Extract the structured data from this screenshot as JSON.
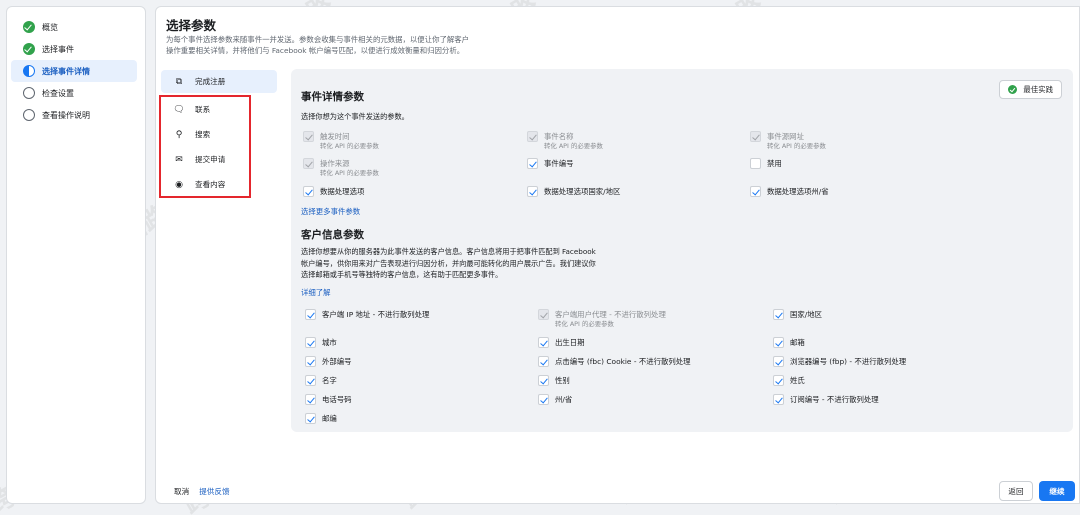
{
  "steps": [
    {
      "label": "概览",
      "state": "done"
    },
    {
      "label": "选择事件",
      "state": "done"
    },
    {
      "label": "选择事件详情",
      "state": "current"
    },
    {
      "label": "检查设置",
      "state": "todo"
    },
    {
      "label": "查看操作说明",
      "state": "todo"
    }
  ],
  "header": {
    "title": "选择参数",
    "desc_line1": "为每个事件选择参数来随事件一并发送。参数会收集与事件相关的元数据，以便让你了解客户",
    "desc_line2": "操作重要相关详情，并将他们与 Facebook 帐户编号匹配，以便进行成效衡量和归因分析。"
  },
  "events": [
    {
      "label": "完成注册",
      "icon": "register-icon",
      "glyph": "⧉"
    },
    {
      "label": "联系",
      "icon": "chat-icon",
      "glyph": "🗨"
    },
    {
      "label": "搜索",
      "icon": "search-icon",
      "glyph": "⚲"
    },
    {
      "label": "提交申请",
      "icon": "envelope-icon",
      "glyph": "✉"
    },
    {
      "label": "查看内容",
      "icon": "eye-icon",
      "glyph": "◉"
    }
  ],
  "event_details": {
    "title": "事件详情参数",
    "best_practice": "最佳实践",
    "desc": "选择你想为这个事件发送的参数。",
    "params": [
      {
        "label": "触发时间",
        "sub": "转化 API 的必要参数",
        "state": "disabled"
      },
      {
        "label": "事件名称",
        "sub": "转化 API 的必要参数",
        "state": "disabled"
      },
      {
        "label": "事件源网址",
        "sub": "转化 API 的必要参数",
        "state": "disabled"
      },
      {
        "label": "操作来源",
        "sub": "转化 API 的必要参数",
        "state": "disabled"
      },
      {
        "label": "事件编号",
        "sub": "",
        "state": "checked"
      },
      {
        "label": "禁用",
        "sub": "",
        "state": "unchecked"
      },
      {
        "label": "数据处理选项",
        "sub": "",
        "state": "checked"
      },
      {
        "label": "数据处理选项国家/地区",
        "sub": "",
        "state": "checked"
      },
      {
        "label": "数据处理选项州/省",
        "sub": "",
        "state": "checked"
      }
    ],
    "more_link": "选择更多事件参数"
  },
  "customer_info": {
    "title": "客户信息参数",
    "desc_line1": "选择你想要从你的服务器为此事件发送的客户信息。客户信息将用于把事件匹配到 Facebook",
    "desc_line2": "帐户编号，供你用来对广告表现进行归因分析，并向最可能转化的用户展示广告。我们建议你",
    "desc_line3": "选择邮箱或手机号等独特的客户信息，这有助于匹配更多事件。",
    "learn_more": "详细了解",
    "params": [
      {
        "label": "客户端 IP 地址 - 不进行散列处理",
        "sub": "",
        "state": "checked"
      },
      {
        "label": "客户端用户代理 - 不进行散列处理",
        "sub": "转化 API 的必要参数",
        "state": "disabled"
      },
      {
        "label": "国家/地区",
        "sub": "",
        "state": "checked"
      },
      {
        "label": "城市",
        "sub": "",
        "state": "checked"
      },
      {
        "label": "出生日期",
        "sub": "",
        "state": "checked"
      },
      {
        "label": "邮箱",
        "sub": "",
        "state": "checked"
      },
      {
        "label": "外部编号",
        "sub": "",
        "state": "checked"
      },
      {
        "label": "点击编号 (fbc) Cookie - 不进行散列处理",
        "sub": "",
        "state": "checked"
      },
      {
        "label": "浏览器编号 (fbp) - 不进行散列处理",
        "sub": "",
        "state": "checked"
      },
      {
        "label": "名字",
        "sub": "",
        "state": "checked"
      },
      {
        "label": "性别",
        "sub": "",
        "state": "checked"
      },
      {
        "label": "姓氏",
        "sub": "",
        "state": "checked"
      },
      {
        "label": "电话号码",
        "sub": "",
        "state": "checked"
      },
      {
        "label": "州/省",
        "sub": "",
        "state": "checked"
      },
      {
        "label": "订阅编号 - 不进行散列处理",
        "sub": "",
        "state": "checked"
      },
      {
        "label": "邮编",
        "sub": "",
        "state": "checked"
      }
    ]
  },
  "footer": {
    "cancel": "取消",
    "feedback": "提供反馈",
    "back": "返回",
    "next": "继续"
  },
  "watermark": "跨境出海陆路",
  "colors": {
    "accent": "#1877f2",
    "success": "#31a24c",
    "highlight_box": "#e4262d"
  }
}
